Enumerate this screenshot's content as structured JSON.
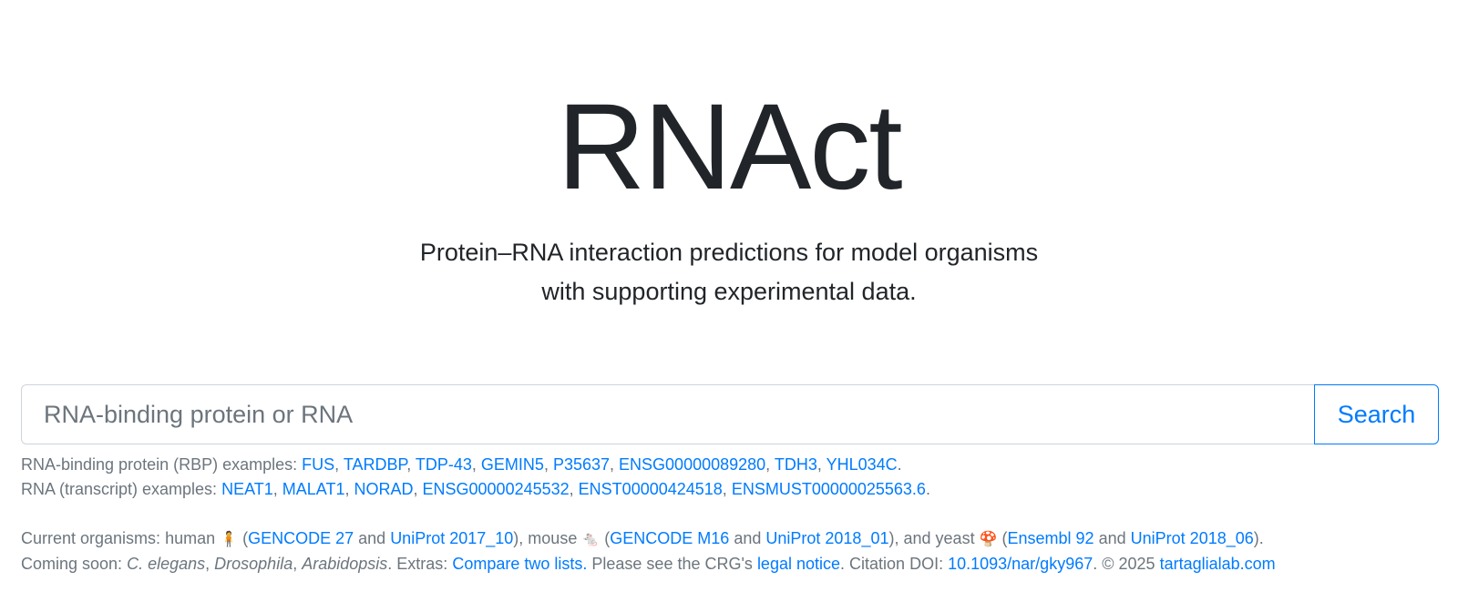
{
  "hero": {
    "title": "RNAct",
    "subtitle_line1": "Protein–RNA interaction predictions for model organisms",
    "subtitle_line2": "with supporting experimental data."
  },
  "search": {
    "placeholder": "RNA-binding protein or RNA",
    "button_label": "Search"
  },
  "rbp_examples": {
    "label": "RNA-binding protein (RBP) examples:",
    "items": [
      "FUS",
      "TARDBP",
      "TDP-43",
      "GEMIN5",
      "P35637",
      "ENSG00000089280",
      "TDH3",
      "YHL034C"
    ]
  },
  "rna_examples": {
    "label": "RNA (transcript) examples:",
    "items": [
      "NEAT1",
      "MALAT1",
      "NORAD",
      "ENSG00000245532",
      "ENST00000424518",
      "ENSMUST00000025563.6"
    ]
  },
  "organisms": {
    "label": "Current organisms:",
    "human": {
      "name": "human",
      "icon": "human-icon",
      "glyph": "🧍",
      "gencode": "GENCODE 27",
      "uniprot": "UniProt 2017_10"
    },
    "mouse": {
      "name": "mouse",
      "icon": "mouse-icon",
      "glyph": "🐁",
      "gencode": "GENCODE M16",
      "uniprot": "UniProt 2018_01"
    },
    "yeast": {
      "name": "yeast",
      "icon": "yeast-icon",
      "glyph": "🍄",
      "ensembl": "Ensembl 92",
      "uniprot": "UniProt 2018_06"
    },
    "and": "and"
  },
  "footer": {
    "coming_soon_label": "Coming soon:",
    "coming_soon": [
      "C. elegans",
      "Drosophila",
      "Arabidopsis"
    ],
    "extras_label": "Extras:",
    "compare_link": "Compare two lists.",
    "legal_prefix": "Please see the CRG's",
    "legal_link": "legal notice",
    "citation_label": "Citation DOI:",
    "doi": "10.1093/nar/gky967",
    "copyright": "© 2025",
    "site_link": "tartaglialab.com"
  }
}
